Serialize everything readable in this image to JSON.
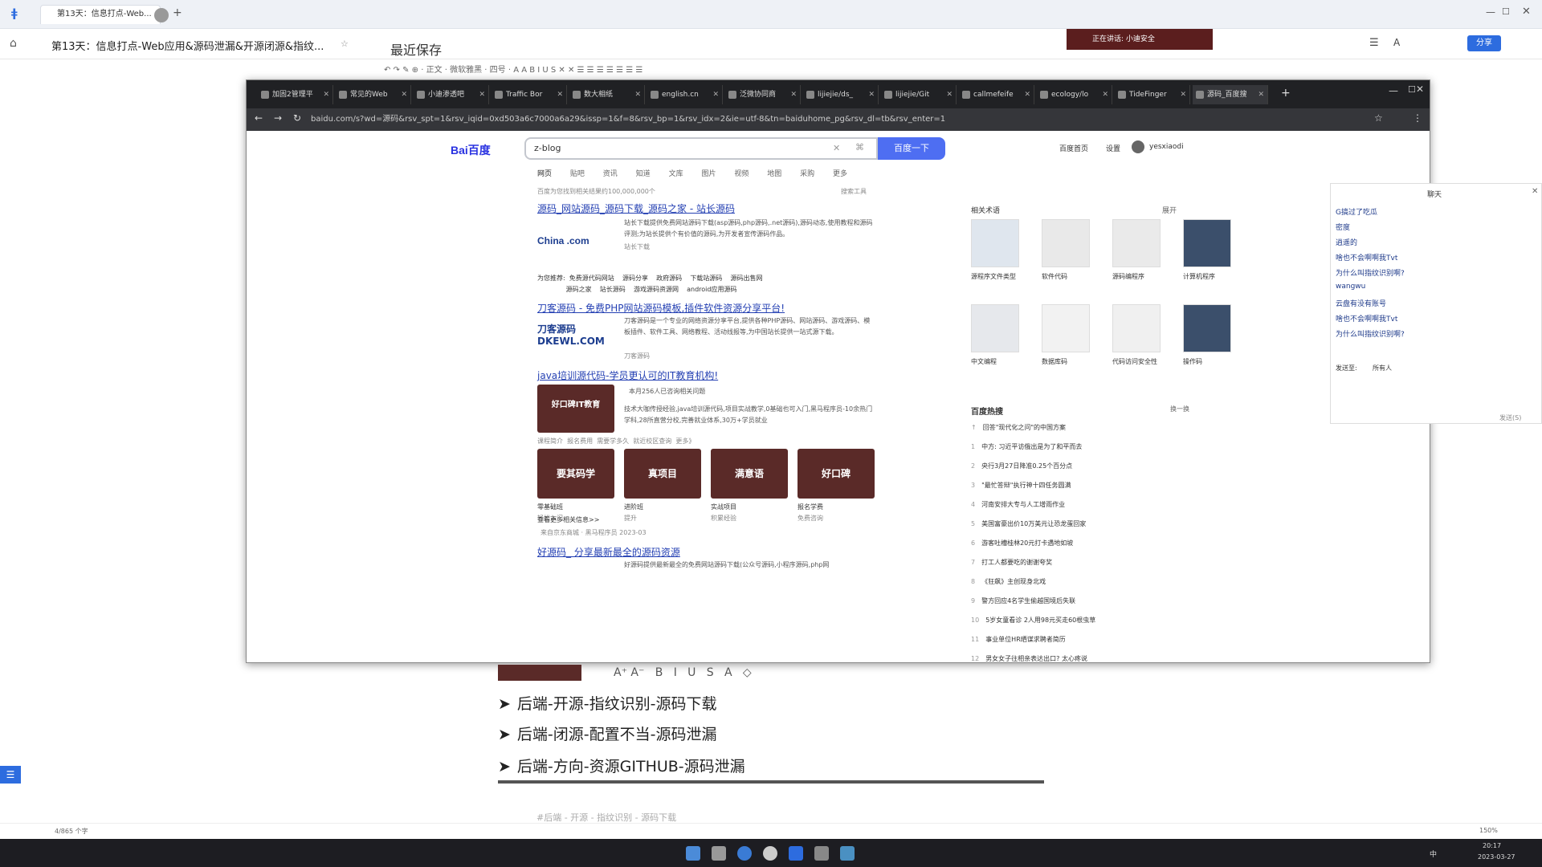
{
  "app": {
    "doc_tab": "第13天：信息打点-Web...",
    "doc_title": "第13天：信息打点-Web应用&源码泄漏&开源闭源&指纹...",
    "saved": "最近保存 ",
    "talk_banner": "正在讲话: 小迪安全",
    "share_label": "分享",
    "zoom": "150%",
    "page_info": "4/865 个字"
  },
  "browser": {
    "tabs": [
      "加固2管理平",
      "常见的Web",
      "小迪渗透吧",
      "Traffic Bor",
      "数大相纸",
      "english.cn",
      "泛微协同商",
      "lijiejie/ds_",
      "lijiejie/Git",
      "callmefeife",
      "ecology/lo",
      "TideFinger",
      "源码_百度搜"
    ],
    "url": "baidu.com/s?wd=源码&rsv_spt=1&rsv_iqid=0xd503a6c7000a6a29&issp=1&f=8&rsv_bp=1&rsv_idx=2&ie=utf-8&tn=baiduhome_pg&rsv_dl=tb&rsv_enter=1"
  },
  "baidu": {
    "logo": "Bai百度",
    "query": "z-blog",
    "search_button": "百度一下",
    "top_links": [
      "百度首页",
      "设置",
      "yesxiaodi"
    ],
    "tabs": [
      "网页",
      "贴吧",
      "资讯",
      "知道",
      "文库",
      "图片",
      "视频",
      "地图",
      "采购",
      "更多"
    ],
    "result_count": "百度为您找到相关结果约100,000,000个",
    "tools": "搜索工具",
    "results": [
      {
        "title": "源码_网站源码_源码下载_源码之家 - 站长源码",
        "text": "站长下载提供免费网站源码下载(asp源码,php源码,.net源码),源码动态,使用教程和源码评测;为站长提供个有价值的源码,为开发者宣传源码作品。",
        "site": "站长下载",
        "logo": "China .com"
      },
      {
        "title": "刀客源码 - 免费PHP网站源码模板,插件软件资源分享平台!",
        "text": "刀客源码是一个专业的网络资源分享平台,提供各种PHP源码、网站源码、游戏源码、模板插件、软件工具、网络教程、活动线报等,为中国站长提供一站式源下载。",
        "site": "刀客源码",
        "logo": "刀客源码 DKEWL.COM"
      },
      {
        "title": "java培训源代码-学员更认可的IT教育机构!",
        "text": "本月256人已咨询相关问题",
        "text2": "技术大咖传授经验,java培训源代码,项目实战教学,0基础也可入门,黑马程序员-10余热门学科,28所直营分校,完善就业体系,30万+学员就业",
        "ad": "好口碑IT教育"
      },
      {
        "title": "好源码_ 分享最新最全的源码资源",
        "text": "好源码提供最新最全的免费网站源码下载(公众号源码,小程序源码,php网"
      }
    ],
    "hot_searches": [
      "为您推荐:",
      "免费源代码网站",
      "源码分享",
      "政府源码",
      "下载站源码",
      "源码出售网",
      "源码之家",
      "站长源码",
      "游戏源码资源网",
      "android应用源码"
    ],
    "ad_thumbs": [
      {
        "label": "要其码学",
        "sub": "零基础班",
        "sub2": "轻松入门"
      },
      {
        "label": "真项目",
        "sub": "进阶班",
        "sub2": "提升"
      },
      {
        "label": "满意语",
        "sub": "实战项目",
        "sub2": "积累经验"
      },
      {
        "label": "好口碑",
        "sub": "报名学费",
        "sub2": "免费咨询"
      }
    ],
    "ad_links": [
      "课程简介",
      "报名费用",
      "需要学多久",
      "就近校区查询",
      "更多》"
    ],
    "ad_more": "查看更多相关信息>>",
    "ad_footer": "来自京东商城 · 黑马程序员 2023-03",
    "related_title": "相关术语",
    "related_expand": "展开",
    "related": [
      "源程序文件类型",
      "软件代码",
      "源码编程序",
      "计算机程序",
      "中文编程",
      "数据库码",
      "代码访问安全性",
      "操作码"
    ],
    "hot_title": "百度热搜",
    "hot_refresh": "换一换",
    "hot_list": [
      "回答\"现代化之问\"的中国方案",
      "中方: 习近平访俄出是为了和平而去",
      "央行3月27日降准0.25个百分点",
      "\"最忙答辩\"执行神十四任务圆满",
      "河南安排大专与人工增雨作业",
      "美国富豪出价10万美元让恐龙蛋回家",
      "游客吐槽桂林20元打卡遇地如坡",
      "打工人都要吃的谢谢夸奖",
      "《狂飙》主创现身北戏",
      "警方回应4名学生偷越国境后失联",
      "5岁女童看诊 2人用98元买走60根虫草",
      "事业单位HR晒谋求聘者简历",
      "男女女子往相亲表达出口? 太心疼说"
    ]
  },
  "chat": {
    "title": "聊天",
    "lines": [
      "G搞过了吃瓜",
      "密度",
      "逍遥的",
      "啥也不会啊啊我Tvt",
      "为什么叫指纹识别啊?",
      "wangwu",
      "云盘有没有账号",
      "啥也不会啊啊我Tvt",
      "为什么叫指纹识别啊?"
    ],
    "send_to_label": "发送至:",
    "send_to": "所有人",
    "send_button": "发送(S)"
  },
  "doc": {
    "bullets": [
      "后端-开源-指纹识别-源码下载",
      "后端-闭源-配置不当-源码泄漏",
      "后端-方向-资源GITHUB-源码泄漏"
    ],
    "footer_ghost": "#后端 - 开源 - 指纹识别 - 源码下载"
  },
  "taskbar": {
    "time": "20:17",
    "date": "2023-03-27",
    "lang": "中"
  }
}
